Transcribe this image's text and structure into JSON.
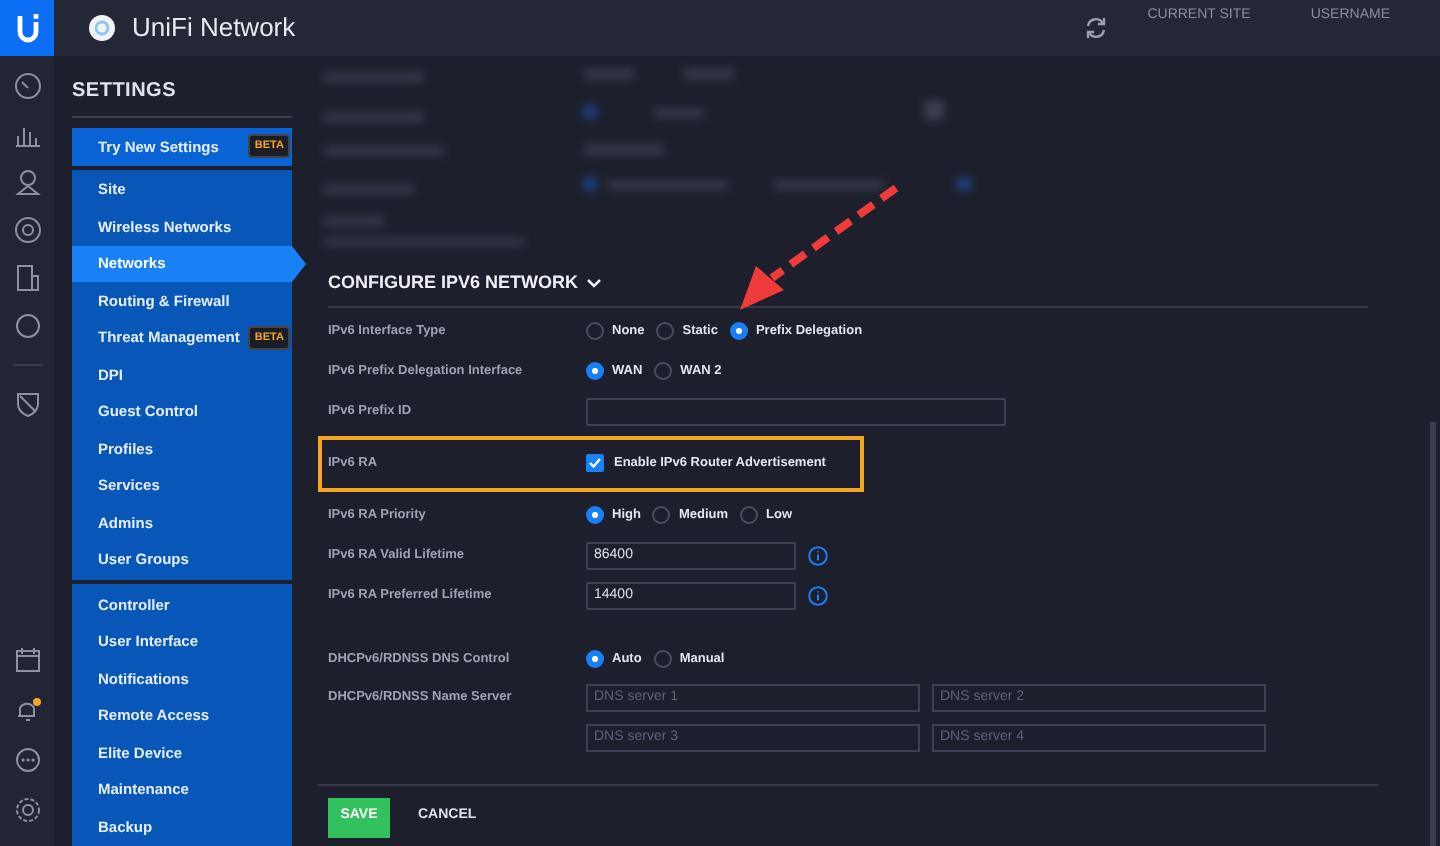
{
  "header": {
    "title": "UniFi Network",
    "current_site_label": "CURRENT SITE",
    "username_label": "USERNAME"
  },
  "sidebar": {
    "heading": "SETTINGS",
    "groups": [
      [
        {
          "label": "Try New Settings",
          "badge": "BETA",
          "selected": false
        }
      ],
      [
        {
          "label": "Site",
          "selected": false
        },
        {
          "label": "Wireless Networks",
          "selected": false
        },
        {
          "label": "Networks",
          "selected": true
        },
        {
          "label": "Routing & Firewall",
          "selected": false
        },
        {
          "label": "Threat Management",
          "badge": "BETA",
          "selected": false
        },
        {
          "label": "DPI",
          "selected": false
        },
        {
          "label": "Guest Control",
          "selected": false
        },
        {
          "label": "Profiles",
          "selected": false
        },
        {
          "label": "Services",
          "selected": false
        },
        {
          "label": "Admins",
          "selected": false
        },
        {
          "label": "User Groups",
          "selected": false
        }
      ],
      [
        {
          "label": "Controller",
          "selected": false
        },
        {
          "label": "User Interface",
          "selected": false
        },
        {
          "label": "Notifications",
          "selected": false
        },
        {
          "label": "Remote Access",
          "selected": false
        },
        {
          "label": "Elite Device",
          "selected": false
        },
        {
          "label": "Maintenance",
          "selected": false
        },
        {
          "label": "Backup",
          "selected": false
        }
      ]
    ]
  },
  "section": {
    "title": "CONFIGURE IPV6 NETWORK",
    "expanded": true
  },
  "rows": [
    {
      "kind": "radio",
      "label": "IPv6 Interface Type",
      "options": [
        {
          "label": "None",
          "selected": false
        },
        {
          "label": "Static",
          "selected": false
        },
        {
          "label": "Prefix Delegation",
          "selected": true
        }
      ]
    },
    {
      "kind": "radio",
      "label": "IPv6 Prefix Delegation Interface",
      "options": [
        {
          "label": "WAN",
          "selected": true
        },
        {
          "label": "WAN 2",
          "selected": false
        }
      ]
    },
    {
      "kind": "text",
      "label": "IPv6 Prefix ID"
    },
    {
      "kind": "checkbox",
      "label": "IPv6 RA",
      "option": "Enable IPv6 Router Advertisement",
      "checked": true,
      "highlighted": true
    },
    {
      "kind": "radio",
      "label": "IPv6 RA Priority",
      "options": [
        {
          "label": "High",
          "selected": true
        },
        {
          "label": "Medium",
          "selected": false
        },
        {
          "label": "Low",
          "selected": false
        }
      ]
    },
    {
      "kind": "info-text",
      "label": "IPv6 RA Valid Lifetime",
      "value": "86400"
    },
    {
      "kind": "info-text",
      "label": "IPv6 RA Preferred Lifetime",
      "value": "14400"
    },
    {
      "kind": "radio",
      "label": "DHCPv6/RDNSS DNS Control",
      "options": [
        {
          "label": "Auto",
          "selected": true
        },
        {
          "label": "Manual",
          "selected": false
        }
      ]
    },
    {
      "kind": "dns",
      "label": "DHCPv6/RDNSS Name Server",
      "placeholders": [
        "DNS server 1",
        "DNS server 2",
        "DNS server 3",
        "DNS server 4"
      ]
    }
  ],
  "buttons": {
    "save": "SAVE",
    "cancel": "CANCEL"
  }
}
